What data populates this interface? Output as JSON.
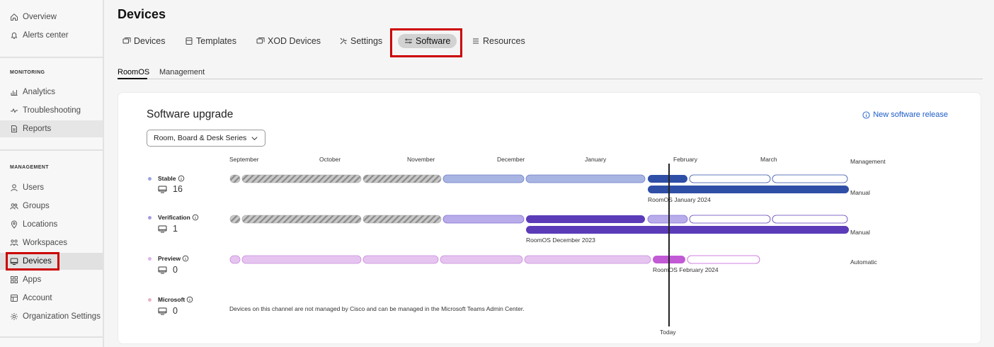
{
  "sidebar": {
    "items_top": [
      {
        "label": "Overview",
        "icon": "home-icon"
      },
      {
        "label": "Alerts center",
        "icon": "bell-icon"
      }
    ],
    "monitoring_label": "MONITORING",
    "monitoring_items": [
      {
        "label": "Analytics",
        "icon": "analytics-icon"
      },
      {
        "label": "Troubleshooting",
        "icon": "pulse-icon"
      },
      {
        "label": "Reports",
        "icon": "report-icon"
      }
    ],
    "management_label": "MANAGEMENT",
    "management_items": [
      {
        "label": "Users",
        "icon": "user-icon"
      },
      {
        "label": "Groups",
        "icon": "group-icon"
      },
      {
        "label": "Locations",
        "icon": "location-icon"
      },
      {
        "label": "Workspaces",
        "icon": "workspaces-icon"
      },
      {
        "label": "Devices",
        "icon": "device-icon"
      },
      {
        "label": "Apps",
        "icon": "apps-icon"
      },
      {
        "label": "Account",
        "icon": "account-icon"
      },
      {
        "label": "Organization Settings",
        "icon": "gear-icon"
      }
    ]
  },
  "header": {
    "title": "Devices",
    "tabs": [
      {
        "label": "Devices",
        "icon": "devices-icon"
      },
      {
        "label": "Templates",
        "icon": "template-icon"
      },
      {
        "label": "XOD Devices",
        "icon": "xod-icon"
      },
      {
        "label": "Settings",
        "icon": "tools-icon"
      },
      {
        "label": "Software",
        "icon": "software-icon"
      },
      {
        "label": "Resources",
        "icon": "list-icon"
      }
    ],
    "subtabs": [
      "RoomOS",
      "Management"
    ]
  },
  "card": {
    "title": "Software upgrade",
    "new_release": "New software release",
    "dropdown_value": "Room, Board & Desk Series",
    "months": [
      "September",
      "October",
      "November",
      "December",
      "January",
      "February",
      "March"
    ],
    "management_header": "Management",
    "channels": [
      {
        "name": "Stable",
        "count": "16",
        "mode": "Manual",
        "version": "RoomOS January 2024",
        "dot_color": "#9aa6de"
      },
      {
        "name": "Verification",
        "count": "1",
        "mode": "Manual",
        "version": "RoomOS December 2023",
        "dot_color": "#a99ade"
      },
      {
        "name": "Preview",
        "count": "0",
        "mode": "Automatic",
        "version": "RoomOS February 2024",
        "dot_color": "#dbb6ea"
      },
      {
        "name": "Microsoft",
        "count": "0",
        "mode": "",
        "version": "",
        "dot_color": "#e8b4c4"
      }
    ],
    "microsoft_note": "Devices on this channel are not managed by Cisco and can be managed in the Microsoft Teams Admin Center.",
    "today_label": "Today"
  },
  "colors": {
    "stable_dark": "#2f4ea6",
    "stable_light": "#a8b4e2",
    "verification_dark": "#5b3bb8",
    "verification_light": "#b9acea",
    "preview_dark": "#c25ad6",
    "preview_light": "#e6c4f0",
    "highlight": "#cc0000"
  }
}
